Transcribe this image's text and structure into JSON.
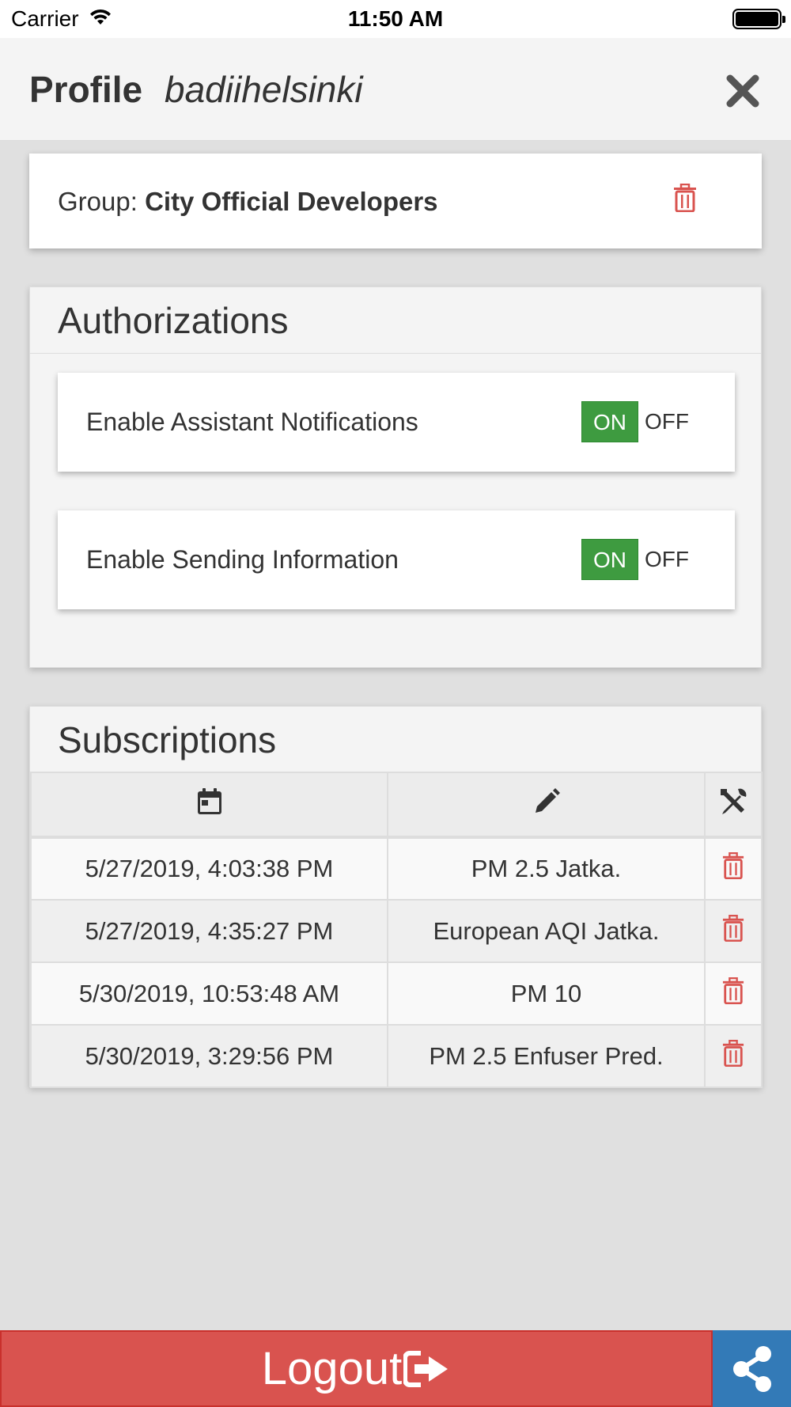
{
  "status_bar": {
    "carrier": "Carrier",
    "time": "11:50 AM"
  },
  "header": {
    "title": "Profile",
    "username": "badiihelsinki"
  },
  "group": {
    "prefix": "Group: ",
    "name": "City Official Developers"
  },
  "authorizations": {
    "title": "Authorizations",
    "items": [
      {
        "label": "Enable Assistant Notifications",
        "on_label": "ON",
        "off_label": "OFF"
      },
      {
        "label": "Enable Sending Information",
        "on_label": "ON",
        "off_label": "OFF"
      }
    ]
  },
  "subscriptions": {
    "title": "Subscriptions",
    "rows": [
      {
        "date": "5/27/2019, 4:03:38 PM",
        "name": "PM 2.5 Jatka."
      },
      {
        "date": "5/27/2019, 4:35:27 PM",
        "name": "European AQI Jatka."
      },
      {
        "date": "5/30/2019, 10:53:48 AM",
        "name": "PM 10"
      },
      {
        "date": "5/30/2019, 3:29:56 PM",
        "name": "PM 2.5 Enfuser Pred."
      }
    ]
  },
  "footer": {
    "logout_label": "Logout"
  },
  "colors": {
    "danger": "#d9534f",
    "success": "#3e9b40",
    "primary": "#337ab7"
  },
  "icons": [
    "wifi-icon",
    "battery-icon",
    "close-icon",
    "trash-icon",
    "calendar-icon",
    "pencil-icon",
    "tools-icon",
    "sign-out-icon",
    "share-icon"
  ]
}
